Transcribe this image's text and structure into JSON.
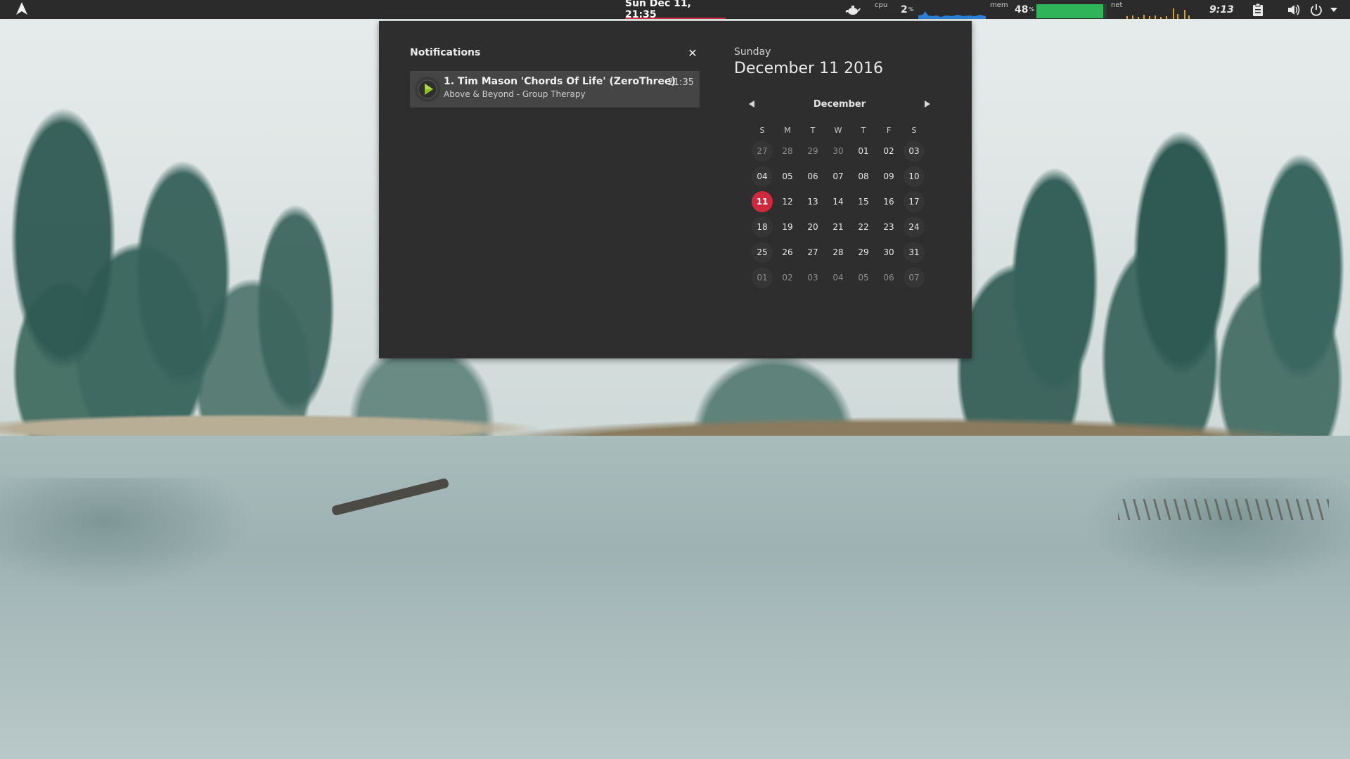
{
  "top_panel": {
    "clock": "Sun Dec 11, 21:35",
    "cpu": {
      "label": "cpu",
      "value": "2",
      "unit": "%"
    },
    "mem": {
      "label": "mem",
      "value": "48",
      "unit": "%",
      "fill_fraction": 0.95
    },
    "net": {
      "label": "net"
    },
    "time": "9:13",
    "accent": "#d0324a",
    "mem_color": "#2fb45a"
  },
  "notifications": {
    "title": "Notifications",
    "close_icon": "close-icon",
    "items": [
      {
        "icon": "media-play-icon",
        "song": "1. Tim Mason 'Chords Of Life' (ZeroThree)",
        "artist": "Above & Beyond - Group Therapy",
        "time": "21:35"
      }
    ]
  },
  "calendar": {
    "weekday": "Sunday",
    "date": "December 11 2016",
    "month": "December",
    "dow": [
      "S",
      "M",
      "T",
      "W",
      "T",
      "F",
      "S"
    ],
    "weeks": [
      [
        "27",
        "28",
        "29",
        "30",
        "01",
        "02",
        "03"
      ],
      [
        "04",
        "05",
        "06",
        "07",
        "08",
        "09",
        "10"
      ],
      [
        "11",
        "12",
        "13",
        "14",
        "15",
        "16",
        "17"
      ],
      [
        "18",
        "19",
        "20",
        "21",
        "22",
        "23",
        "24"
      ],
      [
        "25",
        "26",
        "27",
        "28",
        "29",
        "30",
        "31"
      ],
      [
        "01",
        "02",
        "03",
        "04",
        "05",
        "06",
        "07"
      ]
    ],
    "today": "11",
    "today_color": "#d0283c"
  }
}
